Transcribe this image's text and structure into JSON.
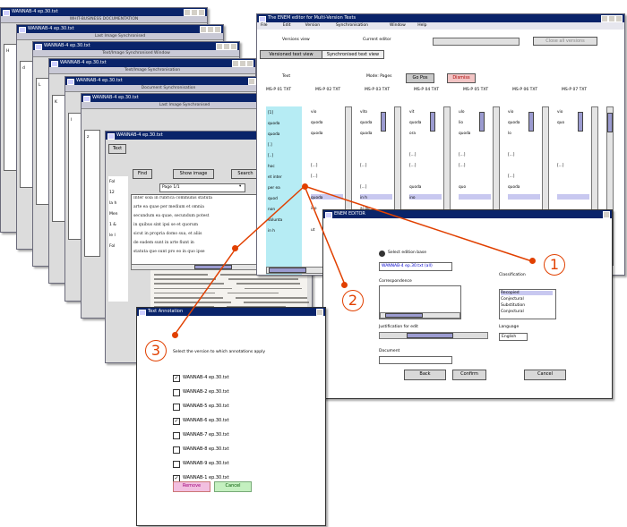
{
  "cascade": {
    "windows": [
      {
        "title": "WANNAB-4 ep.30.txt",
        "tab": "WHIT-BUSINESS DOCUMENTATION"
      },
      {
        "title": "WANNAB-4 ep.30.txt",
        "tab": "Last Image Synchronised"
      },
      {
        "title": "WANNAB-4 ep.30.txt",
        "tab": "Text/Image Synchronised Window"
      },
      {
        "title": "WANNAB-4 ep.30.txt",
        "tab": "Text/Image Synchronisation"
      },
      {
        "title": "WANNAB-4 ep.30.txt",
        "tab": "Document Synchronisation"
      },
      {
        "title": "WANNAB-4 ep.30.txt",
        "tab": "Last Image Synchronised"
      }
    ],
    "side_letters": [
      "H",
      "d",
      "L",
      "K",
      "l",
      "z"
    ],
    "front": {
      "title": "WANNAB-4 ep.30.txt",
      "tab": "Text",
      "find_label": "Find",
      "show_image_label": "Show image",
      "search_label": "Search",
      "page_value": "Page 1/1",
      "side_items": [
        "Fol",
        "12",
        "la h",
        "Men",
        "1 &",
        "le l",
        "Fol"
      ],
      "doc_lines": [
        "Inter sola in rubrica communis statuta",
        "arte ea quae per medium et omnia",
        "secundum ea quae, secundum potest",
        "in quibus sint ipsi se et quorum",
        "sicut in propria domo sua, et aliis",
        "de eadem sunt in arte fiunt in",
        "statuta que sunt pro eo in quo ipse"
      ]
    }
  },
  "main": {
    "title": "The ENEM editor for Multi-Version Texts",
    "menu": [
      "File",
      "Edit",
      "Version",
      "Synchronisation",
      "Window",
      "Help"
    ],
    "label_left": "Versions view",
    "label_right": "Current editor",
    "top_button": "Close all versions",
    "tabs": [
      "Versioned text view",
      "Synchronised text view"
    ],
    "label_text": "Text",
    "label_mode": "Mode: Pages",
    "btn_go": "Go Pos",
    "btn_close": "Dismiss",
    "col_headers": [
      "MS-P 01 TXT",
      "MS-P 02 TXT",
      "MS-P 03 TXT",
      "MS-P 04 TXT",
      "MS-P 05 TXT",
      "MS-P 06 TXT",
      "MS-P 07 TXT"
    ],
    "first_col_rows": [
      "[1]",
      "quoda",
      "quoda",
      "[.]",
      "[..]",
      "hoc",
      "et inter",
      "per ea",
      "quod",
      "non",
      "volunta",
      "in h"
    ],
    "col_rows": [
      [
        "vio",
        "quoda",
        "quoda",
        "",
        "",
        "[...]",
        "[...]",
        "",
        "quoda",
        "ino",
        "",
        "ut"
      ],
      [
        "vito",
        "quoda",
        "quoda",
        "",
        "",
        "[...]",
        "",
        "[...]",
        "in h",
        "ai qu",
        "",
        ""
      ],
      [
        "vit",
        "quoda",
        "ora",
        "",
        "[...]",
        "[...]",
        "",
        "quoda",
        "ino",
        "",
        "",
        ""
      ],
      [
        "ulo",
        "lio",
        "quoda",
        "",
        "[...]",
        "[...]",
        "",
        "quo",
        "",
        "",
        "",
        ""
      ],
      [
        "vio",
        "quoda",
        "lo",
        "",
        "[...]",
        "",
        "[...]",
        "quoda",
        "",
        "",
        "",
        ""
      ],
      [
        "vio",
        "quo",
        "",
        "",
        "",
        "[...]",
        "",
        "",
        "",
        "",
        "",
        ""
      ]
    ]
  },
  "fdlg": {
    "title": "ENEM EDITOR",
    "radio_label": "Select edition base",
    "version_value": "WANNAB-4 ep.30.txt (all)",
    "corr_label": "Correspondence",
    "justif_label": "Justification for edit",
    "dup_label": "Document",
    "classif_label": "Classification",
    "classif_items": [
      "Recopied",
      "Conjectural",
      "Substitution",
      "Conjectural"
    ],
    "lang_label": "Language",
    "lang_value": "English",
    "btn_back": "Back",
    "btn_confirm": "Confirm",
    "btn_cancel": "Cancel"
  },
  "vdlg": {
    "title": "Text Annotation",
    "instruction": "Select the version to which annotations apply",
    "versions": [
      {
        "label": "WANNAB-4 ep.30.txt",
        "checked": true
      },
      {
        "label": "WANNAB-2 ep.30.txt",
        "checked": false
      },
      {
        "label": "WANNAB-5 ep.30.txt",
        "checked": false
      },
      {
        "label": "WANNAB-6 ep.30.txt",
        "checked": true
      },
      {
        "label": "WANNAB-7 ep.30.txt",
        "checked": false
      },
      {
        "label": "WANNAB-8 ep.30.txt",
        "checked": false
      },
      {
        "label": "WANNAB-9 ep.30.txt",
        "checked": false
      },
      {
        "label": "WANNAB-1 ep.30.txt",
        "checked": true
      }
    ],
    "btn_remove": "Remove",
    "btn_cancel": "Cancel"
  },
  "callouts": [
    "1",
    "2",
    "3"
  ],
  "colors": {
    "titlebar": "#0a246a",
    "accent": "#e14000",
    "highlight_column": "#b6ecf4",
    "remove_button": "#f2bfe0",
    "cancel_button": "#c4f0c0"
  }
}
